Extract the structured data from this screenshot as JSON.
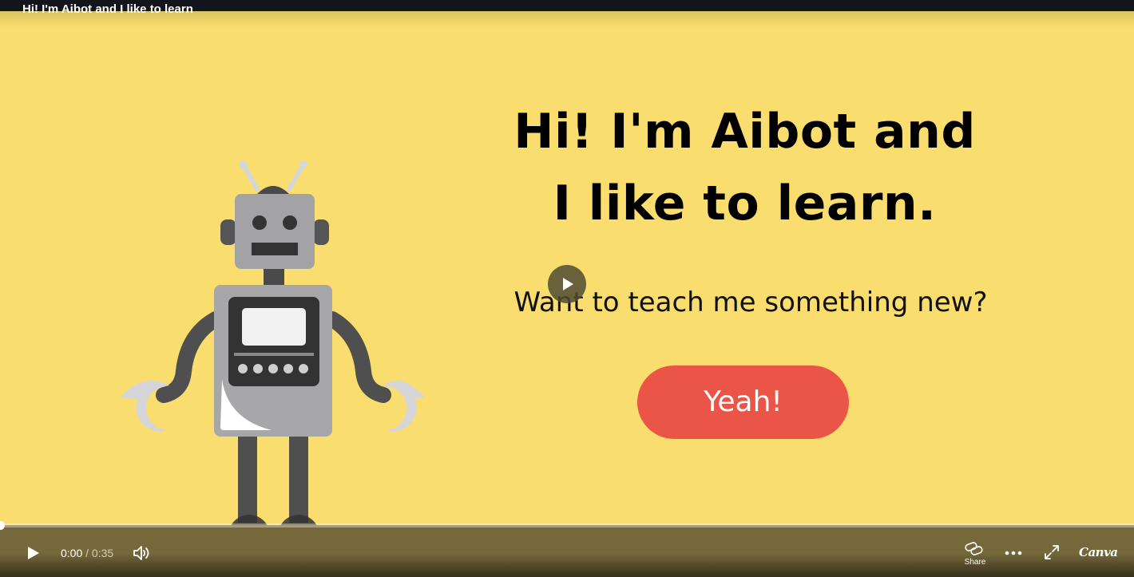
{
  "video": {
    "title": "Hi! I'm Aibot and I like to learn"
  },
  "slide": {
    "headline_line1": "Hi! I'm Aibot and",
    "headline_line2": "I like to learn.",
    "subline": "Want to teach me something new?",
    "button_label": "Yeah!",
    "background_color": "#f9dd6e",
    "button_color": "#eb5547"
  },
  "player": {
    "center_play_icon": "play-icon",
    "progress_fraction": 0.0,
    "time_current": "0:00",
    "time_separator": " / ",
    "time_duration": "0:35",
    "controls": {
      "play_icon": "play-icon",
      "volume_icon": "volume-icon",
      "share_icon": "link-icon",
      "share_label": "Share",
      "more_icon": "more-horizontal-icon",
      "fullscreen_icon": "fullscreen-icon",
      "brand_logo": "Canva"
    }
  }
}
